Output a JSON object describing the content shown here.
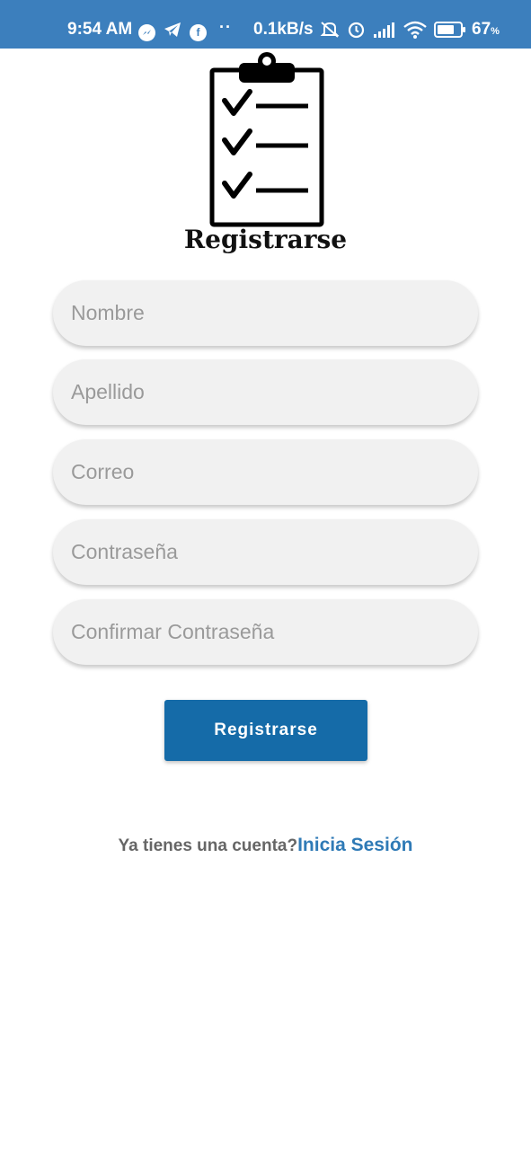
{
  "status_bar": {
    "time": "9:54 AM",
    "speed": "0.1kB/s",
    "battery_percent": "67",
    "battery_unit": "%",
    "icons_left": [
      "messenger-icon",
      "telegram-icon",
      "facebook-icon"
    ],
    "icons_right": [
      "mute-icon",
      "alarm-icon",
      "signal-icon",
      "wifi-icon",
      "battery-icon"
    ],
    "color": "#3c7fbd"
  },
  "header": {
    "logo_icon": "clipboard-checklist-icon",
    "title": "Registrarse"
  },
  "form": {
    "fields": [
      {
        "placeholder": "Nombre",
        "value": ""
      },
      {
        "placeholder": "Apellido",
        "value": ""
      },
      {
        "placeholder": "Correo",
        "value": ""
      },
      {
        "placeholder": "Contraseña",
        "value": ""
      },
      {
        "placeholder": "Confirmar Contraseña",
        "value": ""
      }
    ],
    "submit_label": "Registrarse",
    "accent": "#156ba8"
  },
  "footer": {
    "question": "Ya tienes una cuenta?",
    "link_label": "Inicia Sesión",
    "link_color": "#2f7ab6"
  }
}
